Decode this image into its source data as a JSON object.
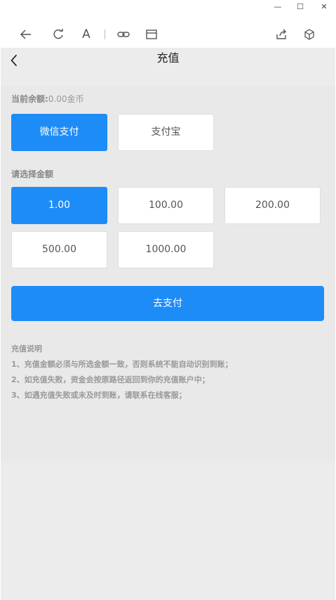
{
  "window": {
    "minimize_glyph": "—",
    "maximize_glyph": "☐",
    "close_glyph": "✕"
  },
  "toolbar": {
    "icons": [
      "back-arrow-icon",
      "refresh-icon",
      "font-icon",
      "link-icon",
      "window-icon",
      "share-icon",
      "cube-icon"
    ],
    "font_glyph": "A"
  },
  "header": {
    "title": "充值"
  },
  "balance": {
    "label": "当前余额:",
    "value": "0.00金币"
  },
  "payment_methods": [
    {
      "label": "微信支付",
      "selected": true
    },
    {
      "label": "支付宝",
      "selected": false
    }
  ],
  "amount_section": {
    "label": "请选择金额",
    "options": [
      {
        "label": "1.00",
        "selected": true
      },
      {
        "label": "100.00",
        "selected": false
      },
      {
        "label": "200.00",
        "selected": false
      },
      {
        "label": "500.00",
        "selected": false
      },
      {
        "label": "1000.00",
        "selected": false
      }
    ]
  },
  "pay_button": {
    "label": "去支付"
  },
  "notes": {
    "title": "充值说明",
    "lines": [
      "1、充值金额必须与所选金额一致，否则系统不能自动识别到账；",
      "2、如充值失败，资金会按原路径返回到你的充值账户中；",
      "3、如遇充值失败或未及时到账，请联系在线客服；"
    ]
  },
  "colors": {
    "accent": "#1e8cf7",
    "page_bg": "#ececec"
  }
}
